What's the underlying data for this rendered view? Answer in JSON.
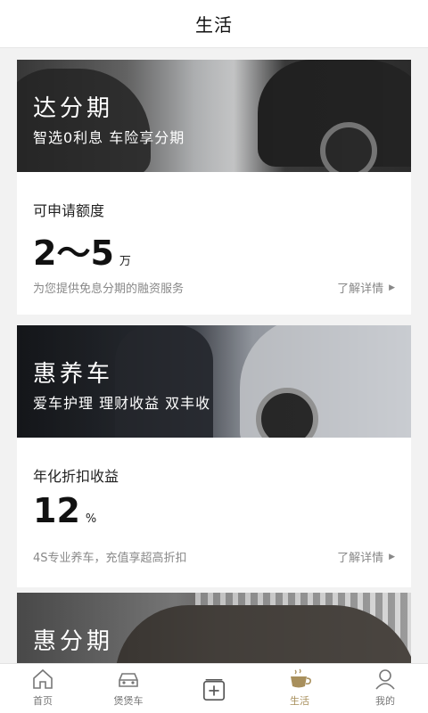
{
  "header": {
    "title": "生活"
  },
  "cards": [
    {
      "banner_title": "达分期",
      "banner_subtitle": "智选0利息  车险享分期",
      "label": "可申请额度",
      "value": "2～5",
      "unit": "万",
      "description": "为您提供免息分期的融资服务",
      "more": "了解详情"
    },
    {
      "banner_title": "惠养车",
      "banner_subtitle": "爱车护理  理财收益  双丰收",
      "label": "年化折扣收益",
      "value": "12",
      "unit": "%",
      "description": "4S专业养车，充值享超高折扣",
      "more": "了解详情"
    },
    {
      "banner_title": "惠分期"
    }
  ],
  "tabbar": {
    "items": [
      {
        "label": "首页",
        "icon": "home-icon"
      },
      {
        "label": "煲煲车",
        "icon": "car-icon"
      },
      {
        "label": "",
        "icon": "add-box-icon"
      },
      {
        "label": "生活",
        "icon": "coffee-cup-icon",
        "active": true
      },
      {
        "label": "我的",
        "icon": "user-icon"
      }
    ],
    "active_color": "#a88f5c"
  }
}
